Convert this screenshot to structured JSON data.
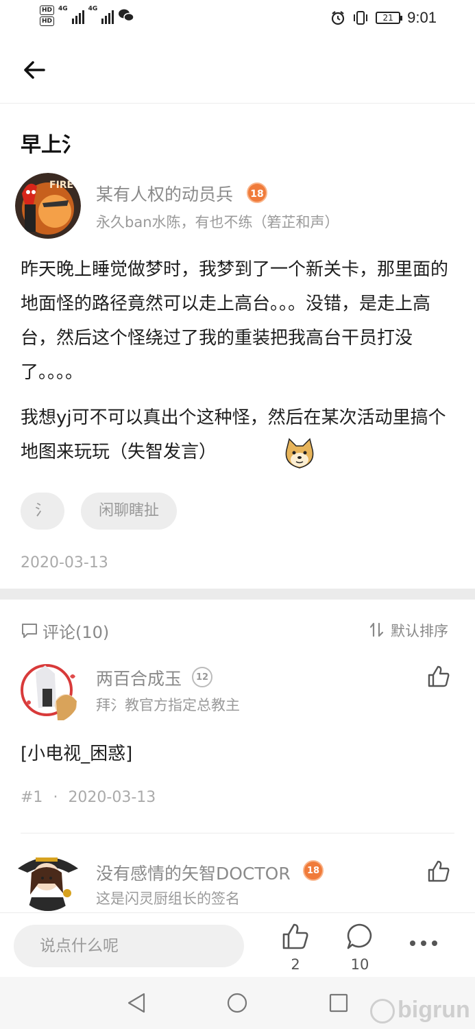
{
  "status_bar": {
    "left_badges": [
      "HD",
      "HD"
    ],
    "network_labels": [
      "4G",
      "4G"
    ],
    "battery": "21",
    "time": "9:01"
  },
  "post": {
    "title": "早上氵",
    "author": {
      "name": "某有人权的动员兵",
      "level": "18",
      "signature": "永久ban水陈，有也不练（箬芷和声）"
    },
    "paragraphs": [
      "昨天晚上睡觉做梦时，我梦到了一个新关卡，那里面的地面怪的路径竟然可以走上高台。。。没错，是走上高台，然后这个怪绕过了我的重装把我高台干员打没了。。。。",
      "我想yj可不可以真出个这种怪，然后在某次活动里搞个地图来玩玩（失智发言）"
    ],
    "tags": [
      "氵",
      "闲聊瞎扯"
    ],
    "date": "2020-03-13"
  },
  "comments_section": {
    "title": "评论(10)",
    "sort_label": "默认排序",
    "comments": [
      {
        "name": "两百合成玉",
        "level": "12",
        "signature": "拜氵教官方指定总教主",
        "text": "[小电视_困惑]",
        "floor": "#1",
        "separator": "·",
        "date": "2020-03-13"
      },
      {
        "name": "没有感情的矢智DOCTOR",
        "level": "18",
        "signature": "这是闪灵厨组长的签名"
      }
    ]
  },
  "action_bar": {
    "input_placeholder": "说点什么呢",
    "like_count": "2",
    "comment_count": "10"
  },
  "watermark": "bigrun",
  "colors": {
    "level_orange": "#f07b3a",
    "muted_text": "#8a8a8a",
    "divider": "#ebebeb"
  },
  "icons": [
    "back-arrow-icon",
    "comment-icon",
    "sort-icon",
    "like-icon",
    "more-icon",
    "nav-back-icon",
    "nav-home-icon",
    "nav-recent-icon"
  ]
}
